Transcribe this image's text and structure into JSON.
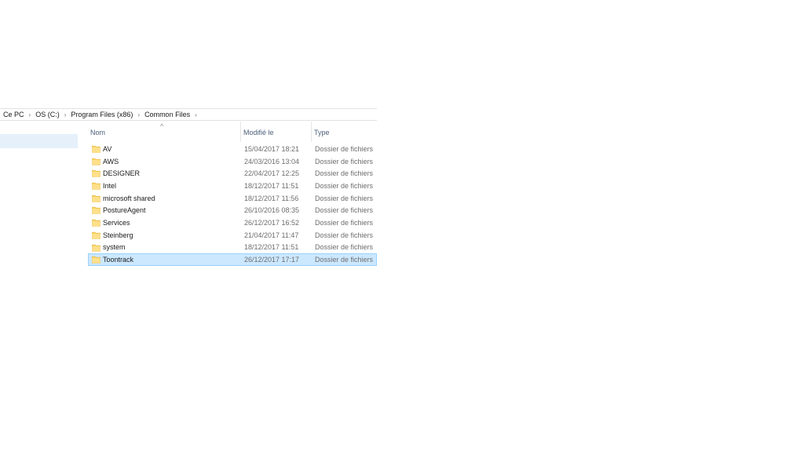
{
  "breadcrumb": {
    "items": [
      "Ce PC",
      "OS (C:)",
      "Program Files (x86)",
      "Common Files"
    ],
    "separator": "›"
  },
  "columns": {
    "name": "Nom",
    "modified": "Modifié le",
    "type": "Type",
    "sort_indicator": "^"
  },
  "files": [
    {
      "name": "AV",
      "modified": "15/04/2017 18:21",
      "type": "Dossier de fichiers"
    },
    {
      "name": "AWS",
      "modified": "24/03/2016 13:04",
      "type": "Dossier de fichiers"
    },
    {
      "name": "DESIGNER",
      "modified": "22/04/2017 12:25",
      "type": "Dossier de fichiers"
    },
    {
      "name": "Intel",
      "modified": "18/12/2017 11:51",
      "type": "Dossier de fichiers"
    },
    {
      "name": "microsoft shared",
      "modified": "18/12/2017 11:56",
      "type": "Dossier de fichiers"
    },
    {
      "name": "PostureAgent",
      "modified": "26/10/2016 08:35",
      "type": "Dossier de fichiers"
    },
    {
      "name": "Services",
      "modified": "26/12/2017 16:52",
      "type": "Dossier de fichiers"
    },
    {
      "name": "Steinberg",
      "modified": "21/04/2017 11:47",
      "type": "Dossier de fichiers"
    },
    {
      "name": "system",
      "modified": "18/12/2017 11:51",
      "type": "Dossier de fichiers"
    },
    {
      "name": "Toontrack",
      "modified": "26/12/2017 17:17",
      "type": "Dossier de fichiers",
      "selected": true
    }
  ],
  "icons": {
    "folder": "folder-icon"
  },
  "colors": {
    "selection_bg": "#cce8ff",
    "selection_border": "#99d1ff",
    "nav_selected_bg": "#e5f0fb",
    "folder_yellow": "#ffd764",
    "header_text": "#4c607a"
  }
}
